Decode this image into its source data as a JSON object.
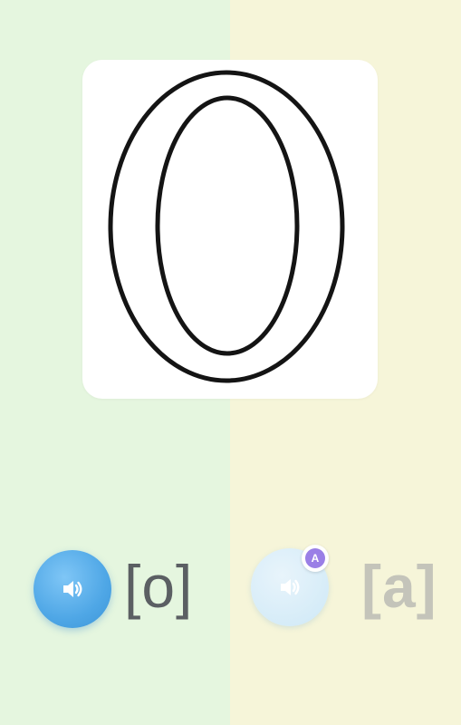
{
  "card": {
    "letter": "0"
  },
  "options": [
    {
      "phoneme": "[o]",
      "state": "active",
      "button_icon": "speaker-icon",
      "button_color": "#4fa7e6"
    },
    {
      "phoneme": "[a]",
      "state": "inactive",
      "button_icon": "speaker-icon",
      "button_color": "#d6ecf8",
      "badge": "A",
      "badge_color": "#9a7fe6"
    }
  ],
  "colors": {
    "left_panel": "#e5f6df",
    "right_panel": "#f6f5d9",
    "outline": "#141414"
  }
}
